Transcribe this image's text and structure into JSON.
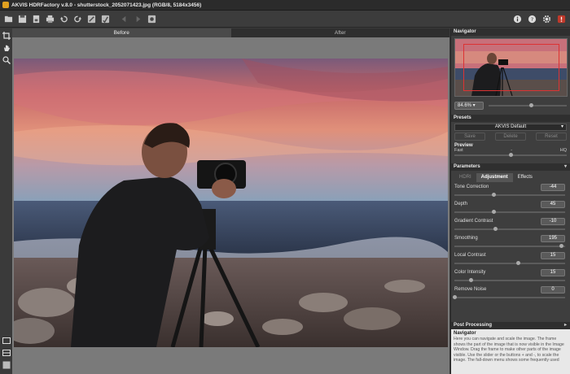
{
  "window": {
    "title": "AKVIS HDRFactory v.8.0 - shutterstock_2052071423.jpg (RGB/8, 5184x3456)"
  },
  "canvas": {
    "tab_before": "Before",
    "tab_after": "After"
  },
  "navigator": {
    "title": "Navigator",
    "zoom": "84.6% ▾",
    "zoom_slider": 0.55
  },
  "presets": {
    "title": "Presets",
    "selected": "AKVIS Default",
    "save": "Save",
    "delete": "Delete",
    "reset": "Reset"
  },
  "preview": {
    "label": "Preview",
    "fast": "Fast",
    "mid": "-",
    "hq": "HQ",
    "slider": 0.5
  },
  "parameters": {
    "title": "Parameters",
    "tabs": [
      "HDRI",
      "Adjustment",
      "Effects"
    ],
    "items": [
      {
        "name": "Tone Correction",
        "value": "-44",
        "pos": 0.36
      },
      {
        "name": "Depth",
        "value": "45",
        "pos": 0.36
      },
      {
        "name": "Gradient Contrast",
        "value": "-10",
        "pos": 0.37
      },
      {
        "name": "Smoothing",
        "value": "195",
        "pos": 0.97
      },
      {
        "name": "Local Contrast",
        "value": "15",
        "pos": 0.58
      },
      {
        "name": "Color Intensity",
        "value": "15",
        "pos": 0.15
      },
      {
        "name": "Remove Noise",
        "value": "0",
        "pos": 0.0
      }
    ]
  },
  "post_processing": {
    "title": "Post Processing"
  },
  "help": {
    "title": "Navigator",
    "text": "Here you can navigate and scale the image. The frame shows the part of the image that is now visible in the Image Window. Drag the frame to make other parts of the image visible. Use the slider or the buttons + and -, to scale the image. The fall-down menu shows some frequently used"
  },
  "icons": {
    "toolbar": [
      "open-icon",
      "save-icon",
      "batch-icon",
      "print-icon",
      "undo-icon",
      "redo-icon",
      "run-icon",
      "run-after-icon",
      "back-icon",
      "forward-icon",
      "plugin-icon"
    ],
    "right": [
      "info-icon",
      "help-icon",
      "settings-icon",
      "feedback-icon"
    ]
  }
}
